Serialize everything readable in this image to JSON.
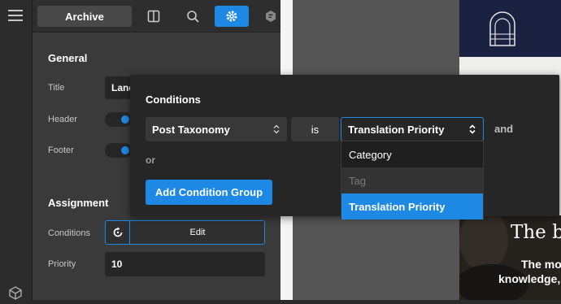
{
  "topbar": {
    "archive_label": "Archive"
  },
  "settings": {
    "general_heading": "General",
    "title_label": "Title",
    "title_value": "Land",
    "header_label": "Header",
    "footer_label": "Footer",
    "header_enabled": true,
    "footer_enabled": true,
    "assignment_heading": "Assignment",
    "conditions_label": "Conditions",
    "edit_label": "Edit",
    "priority_label": "Priority",
    "priority_value": "10"
  },
  "conditions_popup": {
    "title": "Conditions",
    "field_select": "Post Taxonomy",
    "operator": "is",
    "value_select": "Translation Priority",
    "and_label": "and",
    "or_label": "or",
    "add_group_label": "Add Condition Group",
    "dropdown_options": [
      {
        "label": "Category",
        "state": "normal"
      },
      {
        "label": "Tag",
        "state": "disabled"
      },
      {
        "label": "Translation Priority",
        "state": "selected"
      }
    ]
  },
  "preview": {
    "headline_fragment": "The b",
    "body_line1": "The mo",
    "body_line2": "knowledge,"
  },
  "colors": {
    "accent": "#1e88e5",
    "panel": "#3a3a3a",
    "popup": "#262626",
    "navy": "#1b2140"
  },
  "icons": [
    "hamburger-icon",
    "layout-icon",
    "search-icon",
    "gear-icon",
    "plugin-icon",
    "refresh-icon",
    "chevron-updown-icon",
    "cube-icon",
    "logo-icon"
  ]
}
